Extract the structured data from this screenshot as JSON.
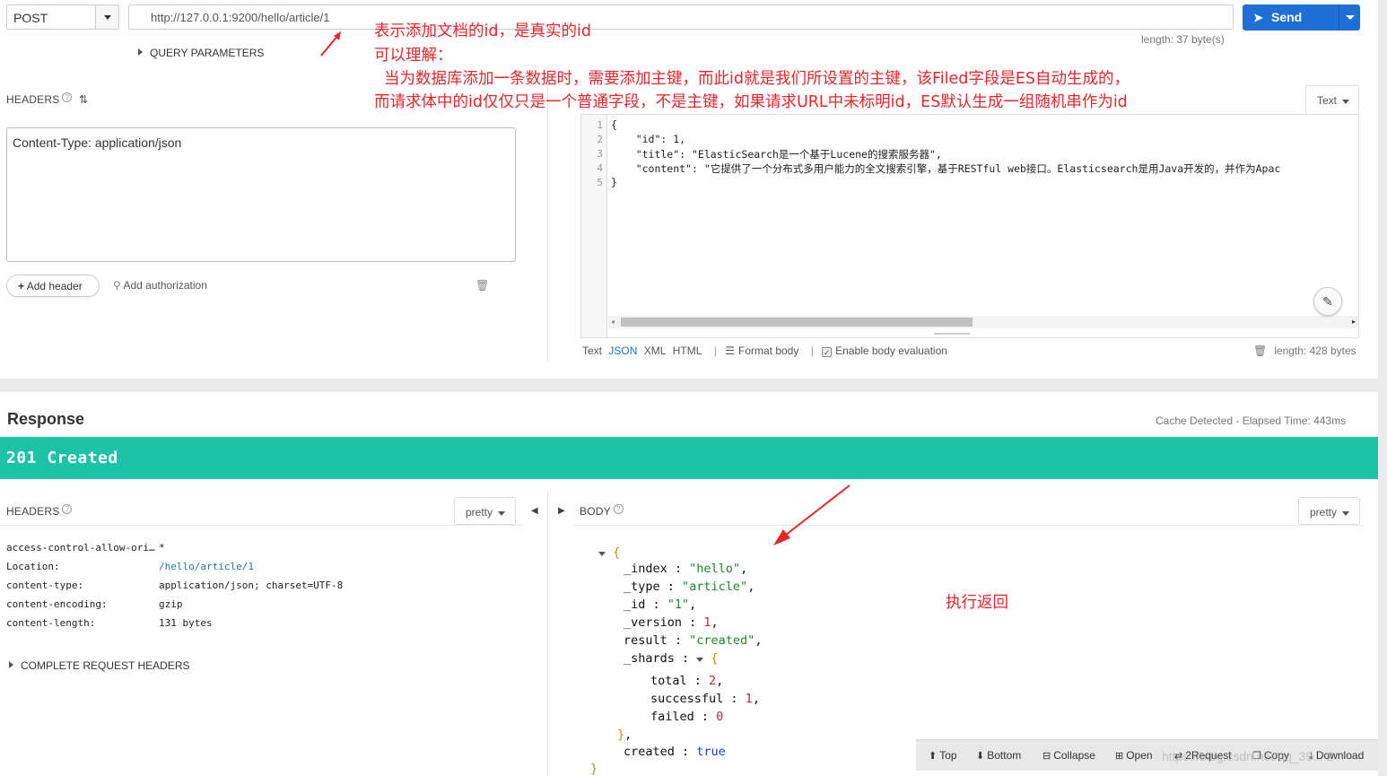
{
  "request": {
    "method": "POST",
    "url": "http://127.0.0.1:9200/hello/article/1",
    "send_label": "Send",
    "url_length": "length: 37 byte(s)",
    "query_parameters_label": "QUERY PARAMETERS",
    "headers_label": "HEADERS",
    "headers_text": "Content-Type: application/json",
    "add_header_label": "Add header",
    "add_authorization_label": "Add authorization",
    "body_mode": "Text",
    "body_lines": [
      {
        "n": "1",
        "text": "{"
      },
      {
        "n": "2",
        "text": "    \"id\": 1,"
      },
      {
        "n": "3",
        "text": "    \"title\": \"ElasticSearch是一个基于Lucene的搜索服务器\","
      },
      {
        "n": "4",
        "text": "    \"content\": \"它提供了一个分布式多用户能力的全文搜索引擎，基于RESTful web接口。Elasticsearch是用Java开发的，并作为Apac"
      },
      {
        "n": "5",
        "text": "}"
      }
    ],
    "format_modes": {
      "text": "Text",
      "json": "JSON",
      "xml": "XML",
      "html": "HTML"
    },
    "format_body_label": "Format body",
    "enable_eval_label": "Enable body evaluation",
    "body_length": "length: 428 bytes"
  },
  "annotations": {
    "line1": "表示添加文档的id，是真实的id",
    "line2": "可以理解：",
    "line3": "当为数据库添加一条数据时，需要添加主键，而此id就是我们所设置的主键，该Filed字段是ES自动生成的，",
    "line4": "而请求体中的id仅仅只是一个普通字段，不是主键，如果请求URL中未标明id，ES默认生成一组随机串作为id",
    "exec_return": "执行返回"
  },
  "response": {
    "title": "Response",
    "timing": "Cache Detected - Elapsed Time: 443ms",
    "status": "201 Created",
    "headers_label": "HEADERS",
    "pretty_label": "pretty",
    "body_label": "BODY",
    "headers": [
      {
        "k": "access-control-allow-ori…",
        "v": "*"
      },
      {
        "k": "Location:",
        "v": "/hello/article/1"
      },
      {
        "k": "content-type:",
        "v": "application/json; charset=UTF-8"
      },
      {
        "k": "content-encoding:",
        "v": "gzip"
      },
      {
        "k": "content-length:",
        "v": "131 bytes"
      }
    ],
    "complete_headers_label": "COMPLETE REQUEST HEADERS",
    "body": {
      "_index": "\"hello\"",
      "_type": "\"article\"",
      "_id": "\"1\"",
      "_version": "1",
      "result": "\"created\"",
      "total": "2",
      "successful": "1",
      "failed": "0",
      "created": "true"
    }
  },
  "toolbar": {
    "top": "Top",
    "bottom": "Bottom",
    "collapse": "Collapse",
    "open": "Open",
    "to_request": "2Request",
    "copy": "Copy",
    "download": "Download"
  },
  "watermark": "https://blog.csdn.net/qq_39... 2",
  "colors": {
    "send": "#1f6fd6",
    "status_bar": "#1dc3a6",
    "annotation": "#e8262a",
    "json_string": "#1a8a2a",
    "json_number": "#c3262e",
    "json_bool": "#1d3fd6"
  }
}
